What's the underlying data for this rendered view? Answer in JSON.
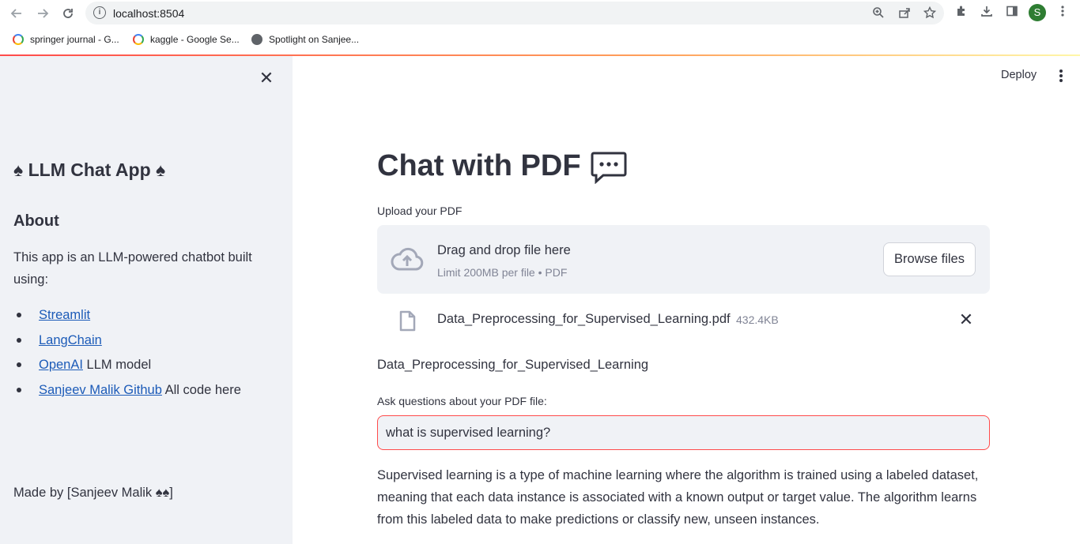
{
  "browser": {
    "url": "localhost:8504",
    "avatar_letter": "S",
    "bookmarks": [
      {
        "label": "springer journal - G...",
        "icon": "google-icon"
      },
      {
        "label": "kaggle - Google Se...",
        "icon": "google-icon"
      },
      {
        "label": "Spotlight on Sanjee...",
        "icon": "globe-icon"
      }
    ]
  },
  "sidebar": {
    "title": "♠ LLM Chat App ♠",
    "about_heading": "About",
    "description": "This app is an LLM-powered chatbot built using:",
    "links": [
      {
        "link_text": "Streamlit",
        "suffix": ""
      },
      {
        "link_text": "LangChain",
        "suffix": ""
      },
      {
        "link_text": "OpenAI",
        "suffix": " LLM model"
      },
      {
        "link_text": "Sanjeev Malik Github",
        "suffix": " All code here"
      }
    ],
    "footer": "Made by [Sanjeev Malik ♠♠]"
  },
  "header": {
    "deploy_label": "Deploy"
  },
  "main": {
    "title": "Chat with PDF",
    "upload_label": "Upload your PDF",
    "dropzone": {
      "main_text": "Drag and drop file here",
      "limit_text": "Limit 200MB per file • PDF",
      "browse_label": "Browse files"
    },
    "uploaded_file": {
      "name": "Data_Preprocessing_for_Supervised_Learning.pdf",
      "size": "432.4KB"
    },
    "document_name": "Data_Preprocessing_for_Supervised_Learning",
    "question_label": "Ask questions about your PDF file:",
    "question_value": "what is supervised learning?",
    "answer": "Supervised learning is a type of machine learning where the algorithm is trained using a labeled dataset, meaning that each data instance is associated with a known output or target value. The algorithm learns from this labeled data to make predictions or classify new, unseen instances."
  },
  "colors": {
    "accent": "#ff4b4b",
    "link": "#1c5bb8",
    "sidebar_bg": "#f0f2f6",
    "text": "#31333f"
  }
}
